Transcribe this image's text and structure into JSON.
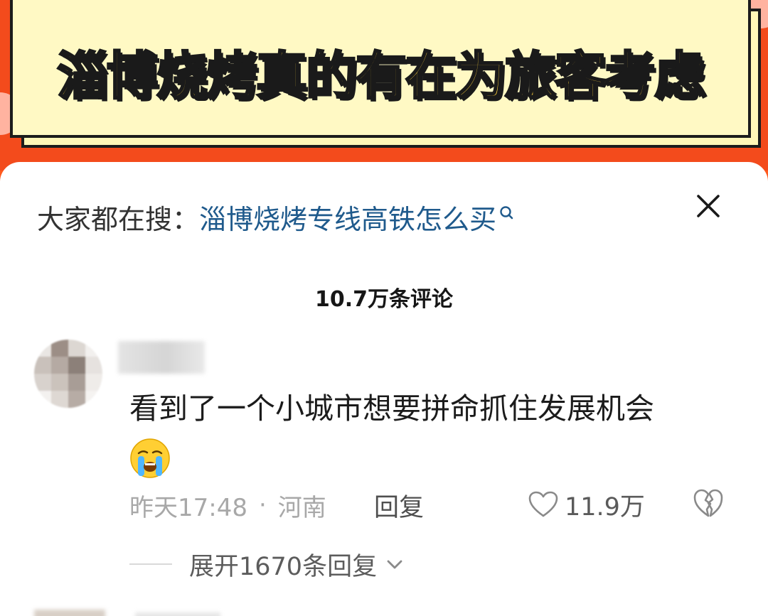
{
  "banner": {
    "title": "淄博烧烤真的有在为旅客考虑"
  },
  "search": {
    "prefix": "大家都在搜：",
    "query": "淄博烧烤专线高铁怎么买",
    "icon": "search-icon"
  },
  "comments_header": {
    "count_label": "10.7万条评论"
  },
  "comment": {
    "text": "看到了一个小城市想要拼命抓住发展机会",
    "emoji": "loudly-crying-face",
    "time": "昨天17:48",
    "separator": "·",
    "location": "河南",
    "reply_label": "回复",
    "like_count": "11.9万",
    "expand_label": "展开1670条回复"
  },
  "colors": {
    "banner_bg": "#f34b1c",
    "banner_card": "#fff9c4",
    "title_fill": "#ffd23c",
    "link": "#1f5a8c",
    "meta_text": "#a8a8a8"
  }
}
